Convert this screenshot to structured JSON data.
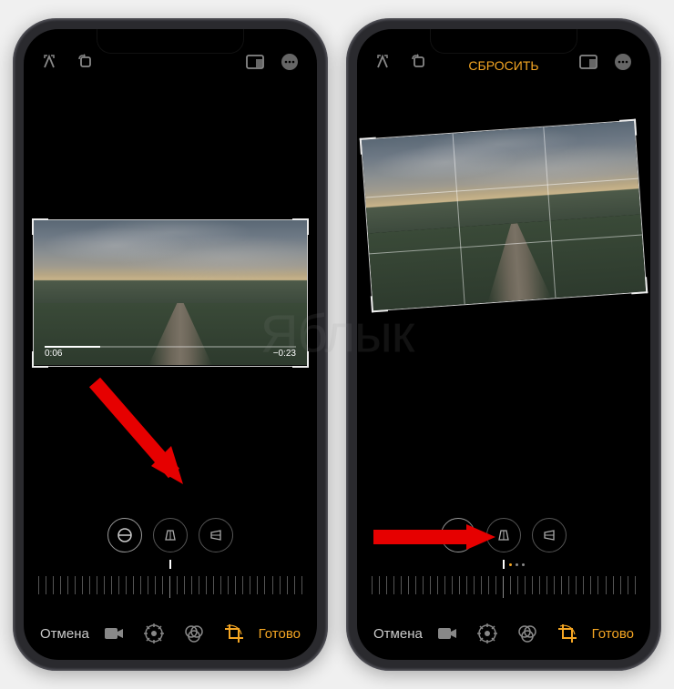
{
  "left": {
    "top": {
      "reset": null
    },
    "video": {
      "elapsed": "0:06",
      "remaining": "−0:23"
    },
    "tools": {
      "straighten_value": null
    },
    "bottom": {
      "cancel": "Отмена",
      "done": "Готово"
    }
  },
  "right": {
    "top": {
      "reset": "СБРОСИТЬ"
    },
    "tools": {
      "straighten_value": "-6"
    },
    "bottom": {
      "cancel": "Отмена",
      "done": "Готово"
    }
  },
  "watermark": "Яблык"
}
